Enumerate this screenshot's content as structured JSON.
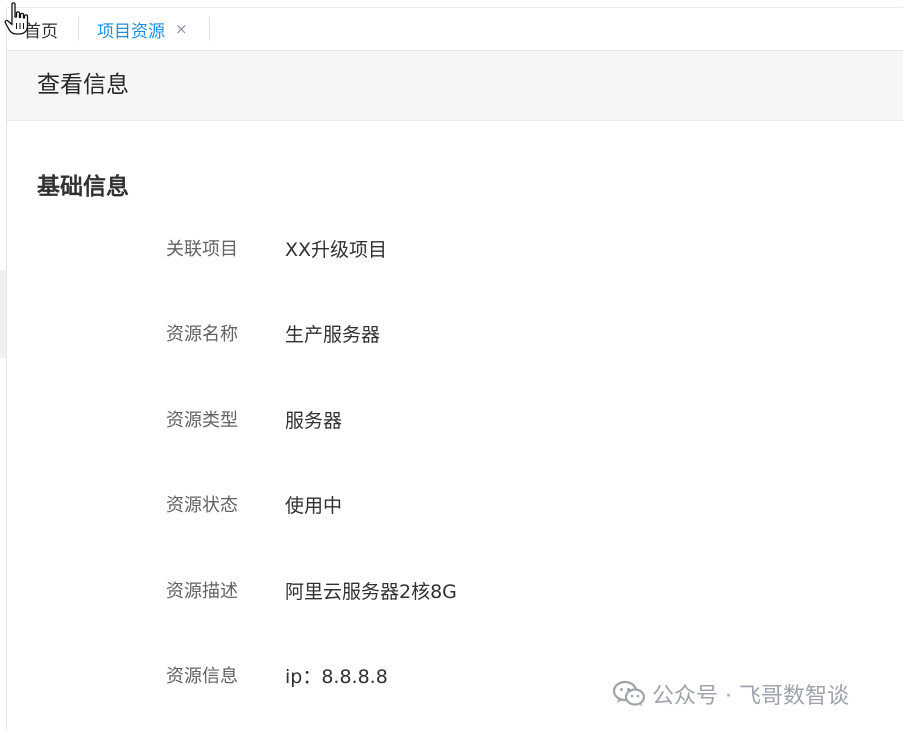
{
  "tabs": [
    {
      "label": "首页",
      "active": false
    },
    {
      "label": "项目资源",
      "active": true,
      "close_icon": "×"
    }
  ],
  "header": {
    "title": "查看信息"
  },
  "section": {
    "title": "基础信息"
  },
  "fields": [
    {
      "label": "关联项目",
      "value": "XX升级项目"
    },
    {
      "label": "资源名称",
      "value": "生产服务器"
    },
    {
      "label": "资源类型",
      "value": "服务器"
    },
    {
      "label": "资源状态",
      "value": "使用中"
    },
    {
      "label": "资源描述",
      "value": "阿里云服务器2核8G"
    },
    {
      "label": "资源信息",
      "value": "ip：8.8.8.8"
    }
  ],
  "watermark": {
    "text": "公众号 · 飞哥数智谈",
    "icon": "wechat-icon"
  },
  "colors": {
    "active_tab": "#1f8fdd",
    "header_bg": "#f5f6f8",
    "label": "#606266",
    "value": "#303133",
    "watermark": "#9ea3ab"
  },
  "cursor": {
    "icon": "hand-pointer-icon"
  }
}
